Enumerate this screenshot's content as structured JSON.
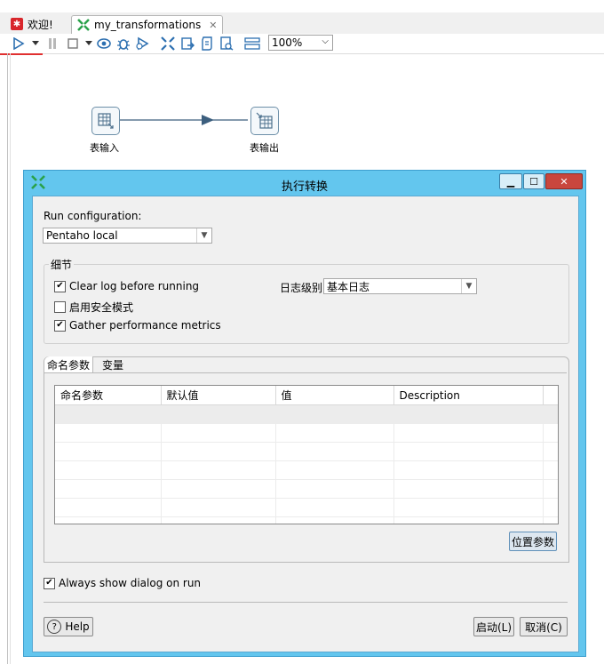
{
  "tabs": [
    {
      "label": "欢迎!",
      "icon": "welcome-icon"
    },
    {
      "label": "my_transformations",
      "icon": "transformation-icon",
      "close_icon": "close-icon"
    }
  ],
  "toolbar": {
    "zoom": "100%",
    "icons": [
      "run-icon",
      "run-dropdown-icon",
      "pause-icon",
      "stop-icon",
      "stop-dropdown-icon",
      "preview-icon",
      "debug-icon",
      "replay-icon",
      "verify-icon",
      "impact-icon",
      "sql-icon",
      "explore-db-icon",
      "results-icon"
    ]
  },
  "canvas": {
    "step_input_label": "表输入",
    "step_output_label": "表输出"
  },
  "dialog": {
    "title": "执行转换",
    "run_config_label": "Run configuration:",
    "run_config_value": "Pentaho local",
    "details_group_label": "细节",
    "clear_log_label": "Clear log before running",
    "clear_log_checked": true,
    "safe_mode_label": "启用安全模式",
    "safe_mode_checked": false,
    "gather_metrics_label": "Gather performance metrics",
    "gather_metrics_checked": true,
    "log_level_label": "日志级别",
    "log_level_value": "基本日志",
    "tab_params_label": "命名参数",
    "tab_vars_label": "变量",
    "table_headers": [
      "命名参数",
      "默认值",
      "值",
      "Description"
    ],
    "position_params_button": "位置参数",
    "always_show_label": "Always show dialog on run",
    "always_show_checked": true,
    "help_button": "Help",
    "launch_button": "启动(L)",
    "cancel_button": "取消(C)"
  },
  "colors": {
    "accent": "#63c6ee",
    "close_button": "#c9463d",
    "toolbar_underline": "#e03030"
  }
}
